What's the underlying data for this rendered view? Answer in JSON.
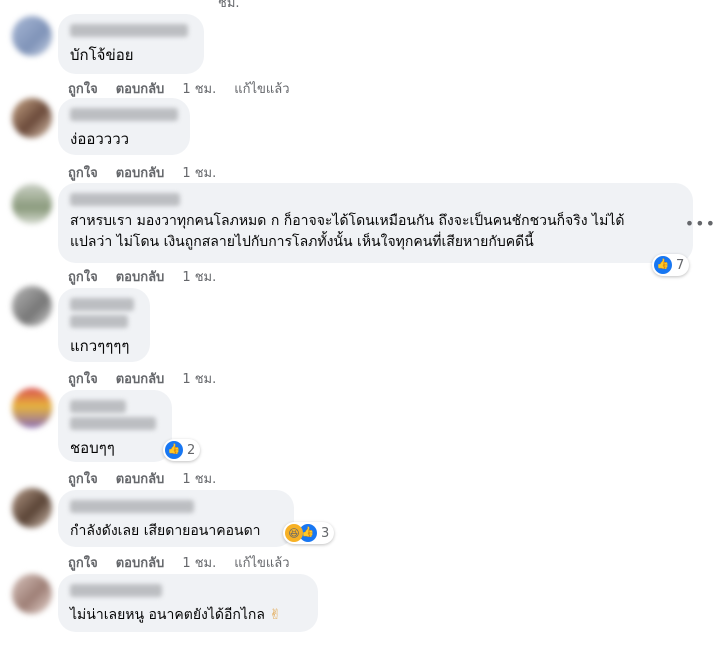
{
  "actions": {
    "like": "ถูกใจ",
    "reply": "ตอบกลับ",
    "edited": "แก้ไขแล้ว"
  },
  "top_time": "ชม.",
  "comments": [
    {
      "text": "บักโจ้ข่อย",
      "time": "1 ชม."
    },
    {
      "text": "ง่ออวววว",
      "time": "1 ชม."
    },
    {
      "line1": "สาหรบเรา มองวาทุกคนโลภหมด ก ก็อาจจะได้โดนเหมือนกัน ถึงจะเป็นคนชักชวนก็จริง ไม่ได้",
      "line2": "แปลว่า ไม่โดน เงินถูกสลายไปกับการโลภทั้งนั้น เห็นใจทุกคนที่เสียหายกับคดีนี้",
      "time": "1 ชม.",
      "reactions": "7"
    },
    {
      "text": "แกวๆๆๆๆ",
      "time": "1 ชม."
    },
    {
      "text": "ชอบๆๆ",
      "time": "1 ชม.",
      "reactions": "2"
    },
    {
      "text": "กำลังดังเลย เสียดายอนาคอนดา",
      "time": "1 ชม.",
      "reactions": "3"
    },
    {
      "text": "ไม่น่าเลยหนู อนาคตยังได้อีกไกล",
      "emoji": "✌",
      "time": ""
    }
  ],
  "colors": {
    "like": "#1877f2",
    "bubble": "#f0f2f5",
    "meta": "#65676b"
  },
  "icons": [
    "like-icon",
    "haha-icon",
    "more-options-icon",
    "victory-hand-icon"
  ]
}
